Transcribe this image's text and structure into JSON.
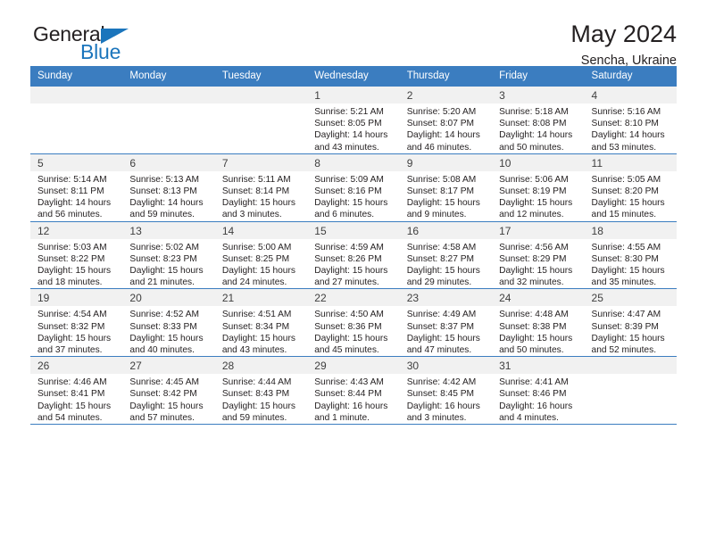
{
  "brand": {
    "name_top": "General",
    "name_bottom": "Blue",
    "triangle_color": "#1b75bc"
  },
  "header": {
    "title": "May 2024",
    "subtitle": "Sencha, Ukraine"
  },
  "theme": {
    "header_blue": "#3b7dc0",
    "daynum_bg": "#f1f1f1",
    "text": "#231f20"
  },
  "labels": {
    "sunrise_prefix": "Sunrise:",
    "sunset_prefix": "Sunset:",
    "daylight_prefix": "Daylight:"
  },
  "weekdays": [
    "Sunday",
    "Monday",
    "Tuesday",
    "Wednesday",
    "Thursday",
    "Friday",
    "Saturday"
  ],
  "weeks": [
    [
      {
        "day": "",
        "empty": true,
        "sunrise": "",
        "sunset": "",
        "daylight_line1": "",
        "daylight_line2": ""
      },
      {
        "day": "",
        "empty": true,
        "sunrise": "",
        "sunset": "",
        "daylight_line1": "",
        "daylight_line2": ""
      },
      {
        "day": "",
        "empty": true,
        "sunrise": "",
        "sunset": "",
        "daylight_line1": "",
        "daylight_line2": ""
      },
      {
        "day": "1",
        "empty": false,
        "sunrise": "Sunrise: 5:21 AM",
        "sunset": "Sunset: 8:05 PM",
        "daylight_line1": "Daylight: 14 hours",
        "daylight_line2": "and 43 minutes."
      },
      {
        "day": "2",
        "empty": false,
        "sunrise": "Sunrise: 5:20 AM",
        "sunset": "Sunset: 8:07 PM",
        "daylight_line1": "Daylight: 14 hours",
        "daylight_line2": "and 46 minutes."
      },
      {
        "day": "3",
        "empty": false,
        "sunrise": "Sunrise: 5:18 AM",
        "sunset": "Sunset: 8:08 PM",
        "daylight_line1": "Daylight: 14 hours",
        "daylight_line2": "and 50 minutes."
      },
      {
        "day": "4",
        "empty": false,
        "sunrise": "Sunrise: 5:16 AM",
        "sunset": "Sunset: 8:10 PM",
        "daylight_line1": "Daylight: 14 hours",
        "daylight_line2": "and 53 minutes."
      }
    ],
    [
      {
        "day": "5",
        "empty": false,
        "sunrise": "Sunrise: 5:14 AM",
        "sunset": "Sunset: 8:11 PM",
        "daylight_line1": "Daylight: 14 hours",
        "daylight_line2": "and 56 minutes."
      },
      {
        "day": "6",
        "empty": false,
        "sunrise": "Sunrise: 5:13 AM",
        "sunset": "Sunset: 8:13 PM",
        "daylight_line1": "Daylight: 14 hours",
        "daylight_line2": "and 59 minutes."
      },
      {
        "day": "7",
        "empty": false,
        "sunrise": "Sunrise: 5:11 AM",
        "sunset": "Sunset: 8:14 PM",
        "daylight_line1": "Daylight: 15 hours",
        "daylight_line2": "and 3 minutes."
      },
      {
        "day": "8",
        "empty": false,
        "sunrise": "Sunrise: 5:09 AM",
        "sunset": "Sunset: 8:16 PM",
        "daylight_line1": "Daylight: 15 hours",
        "daylight_line2": "and 6 minutes."
      },
      {
        "day": "9",
        "empty": false,
        "sunrise": "Sunrise: 5:08 AM",
        "sunset": "Sunset: 8:17 PM",
        "daylight_line1": "Daylight: 15 hours",
        "daylight_line2": "and 9 minutes."
      },
      {
        "day": "10",
        "empty": false,
        "sunrise": "Sunrise: 5:06 AM",
        "sunset": "Sunset: 8:19 PM",
        "daylight_line1": "Daylight: 15 hours",
        "daylight_line2": "and 12 minutes."
      },
      {
        "day": "11",
        "empty": false,
        "sunrise": "Sunrise: 5:05 AM",
        "sunset": "Sunset: 8:20 PM",
        "daylight_line1": "Daylight: 15 hours",
        "daylight_line2": "and 15 minutes."
      }
    ],
    [
      {
        "day": "12",
        "empty": false,
        "sunrise": "Sunrise: 5:03 AM",
        "sunset": "Sunset: 8:22 PM",
        "daylight_line1": "Daylight: 15 hours",
        "daylight_line2": "and 18 minutes."
      },
      {
        "day": "13",
        "empty": false,
        "sunrise": "Sunrise: 5:02 AM",
        "sunset": "Sunset: 8:23 PM",
        "daylight_line1": "Daylight: 15 hours",
        "daylight_line2": "and 21 minutes."
      },
      {
        "day": "14",
        "empty": false,
        "sunrise": "Sunrise: 5:00 AM",
        "sunset": "Sunset: 8:25 PM",
        "daylight_line1": "Daylight: 15 hours",
        "daylight_line2": "and 24 minutes."
      },
      {
        "day": "15",
        "empty": false,
        "sunrise": "Sunrise: 4:59 AM",
        "sunset": "Sunset: 8:26 PM",
        "daylight_line1": "Daylight: 15 hours",
        "daylight_line2": "and 27 minutes."
      },
      {
        "day": "16",
        "empty": false,
        "sunrise": "Sunrise: 4:58 AM",
        "sunset": "Sunset: 8:27 PM",
        "daylight_line1": "Daylight: 15 hours",
        "daylight_line2": "and 29 minutes."
      },
      {
        "day": "17",
        "empty": false,
        "sunrise": "Sunrise: 4:56 AM",
        "sunset": "Sunset: 8:29 PM",
        "daylight_line1": "Daylight: 15 hours",
        "daylight_line2": "and 32 minutes."
      },
      {
        "day": "18",
        "empty": false,
        "sunrise": "Sunrise: 4:55 AM",
        "sunset": "Sunset: 8:30 PM",
        "daylight_line1": "Daylight: 15 hours",
        "daylight_line2": "and 35 minutes."
      }
    ],
    [
      {
        "day": "19",
        "empty": false,
        "sunrise": "Sunrise: 4:54 AM",
        "sunset": "Sunset: 8:32 PM",
        "daylight_line1": "Daylight: 15 hours",
        "daylight_line2": "and 37 minutes."
      },
      {
        "day": "20",
        "empty": false,
        "sunrise": "Sunrise: 4:52 AM",
        "sunset": "Sunset: 8:33 PM",
        "daylight_line1": "Daylight: 15 hours",
        "daylight_line2": "and 40 minutes."
      },
      {
        "day": "21",
        "empty": false,
        "sunrise": "Sunrise: 4:51 AM",
        "sunset": "Sunset: 8:34 PM",
        "daylight_line1": "Daylight: 15 hours",
        "daylight_line2": "and 43 minutes."
      },
      {
        "day": "22",
        "empty": false,
        "sunrise": "Sunrise: 4:50 AM",
        "sunset": "Sunset: 8:36 PM",
        "daylight_line1": "Daylight: 15 hours",
        "daylight_line2": "and 45 minutes."
      },
      {
        "day": "23",
        "empty": false,
        "sunrise": "Sunrise: 4:49 AM",
        "sunset": "Sunset: 8:37 PM",
        "daylight_line1": "Daylight: 15 hours",
        "daylight_line2": "and 47 minutes."
      },
      {
        "day": "24",
        "empty": false,
        "sunrise": "Sunrise: 4:48 AM",
        "sunset": "Sunset: 8:38 PM",
        "daylight_line1": "Daylight: 15 hours",
        "daylight_line2": "and 50 minutes."
      },
      {
        "day": "25",
        "empty": false,
        "sunrise": "Sunrise: 4:47 AM",
        "sunset": "Sunset: 8:39 PM",
        "daylight_line1": "Daylight: 15 hours",
        "daylight_line2": "and 52 minutes."
      }
    ],
    [
      {
        "day": "26",
        "empty": false,
        "sunrise": "Sunrise: 4:46 AM",
        "sunset": "Sunset: 8:41 PM",
        "daylight_line1": "Daylight: 15 hours",
        "daylight_line2": "and 54 minutes."
      },
      {
        "day": "27",
        "empty": false,
        "sunrise": "Sunrise: 4:45 AM",
        "sunset": "Sunset: 8:42 PM",
        "daylight_line1": "Daylight: 15 hours",
        "daylight_line2": "and 57 minutes."
      },
      {
        "day": "28",
        "empty": false,
        "sunrise": "Sunrise: 4:44 AM",
        "sunset": "Sunset: 8:43 PM",
        "daylight_line1": "Daylight: 15 hours",
        "daylight_line2": "and 59 minutes."
      },
      {
        "day": "29",
        "empty": false,
        "sunrise": "Sunrise: 4:43 AM",
        "sunset": "Sunset: 8:44 PM",
        "daylight_line1": "Daylight: 16 hours",
        "daylight_line2": "and 1 minute."
      },
      {
        "day": "30",
        "empty": false,
        "sunrise": "Sunrise: 4:42 AM",
        "sunset": "Sunset: 8:45 PM",
        "daylight_line1": "Daylight: 16 hours",
        "daylight_line2": "and 3 minutes."
      },
      {
        "day": "31",
        "empty": false,
        "sunrise": "Sunrise: 4:41 AM",
        "sunset": "Sunset: 8:46 PM",
        "daylight_line1": "Daylight: 16 hours",
        "daylight_line2": "and 4 minutes."
      },
      {
        "day": "",
        "empty": true,
        "sunrise": "",
        "sunset": "",
        "daylight_line1": "",
        "daylight_line2": ""
      }
    ]
  ]
}
